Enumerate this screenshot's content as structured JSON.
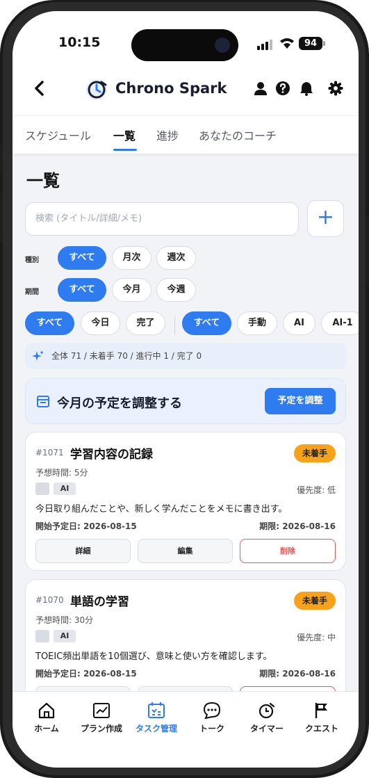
{
  "status_bar": {
    "time": "10:15",
    "battery": "94"
  },
  "header": {
    "app_name": "Chrono Spark"
  },
  "tabs": [
    {
      "label": "スケジュール"
    },
    {
      "label": "一覧"
    },
    {
      "label": "進捗"
    },
    {
      "label": "あなたのコーチ"
    }
  ],
  "page": {
    "title": "一覧",
    "search_placeholder": "検索 (タイトル/詳細/メモ)",
    "add_label": "+"
  },
  "filters": {
    "type_label": "種別",
    "type_options": [
      "すべて",
      "月次",
      "週次"
    ],
    "period_label": "期間",
    "period_options": [
      "すべて",
      "今月",
      "今週"
    ],
    "status_options": [
      "すべて",
      "今日",
      "完了"
    ],
    "source_options": [
      "すべて",
      "手動",
      "AI",
      "AI-1"
    ]
  },
  "stats": {
    "text": "全体 71 / 未着手 70 / 進行中 1 / 完了 0"
  },
  "adjust": {
    "text": "今月の予定を調整する",
    "button": "予定を調整"
  },
  "tasks": [
    {
      "id": "#1071",
      "title": "学習内容の記録",
      "status": "未着手",
      "estimate": "予想時間: 5分",
      "tag": "AI",
      "priority": "優先度: 低",
      "description": "今日取り組んだことや、新しく学んだことをメモに書き出す。",
      "start": "開始予定日: 2026-08-15",
      "due": "期限: 2026-08-16",
      "detail_label": "詳細",
      "edit_label": "編集",
      "delete_label": "削除"
    },
    {
      "id": "#1070",
      "title": "単語の学習",
      "status": "未着手",
      "estimate": "予想時間: 30分",
      "tag": "AI",
      "priority": "優先度: 中",
      "description": "TOEIC頻出単語を10個選び、意味と使い方を確認します。",
      "start": "開始予定日: 2026-08-15",
      "due": "期限: 2026-08-16"
    }
  ],
  "bottom_nav": [
    {
      "label": "ホーム",
      "icon": "home-icon"
    },
    {
      "label": "プラン作成",
      "icon": "chart-icon"
    },
    {
      "label": "タスク管理",
      "icon": "calendar-check-icon"
    },
    {
      "label": "トーク",
      "icon": "chat-icon"
    },
    {
      "label": "タイマー",
      "icon": "timer-icon"
    },
    {
      "label": "クエスト",
      "icon": "flag-icon"
    }
  ],
  "colors": {
    "accent": "#2f7bf0",
    "status_pending": "#f7a21b",
    "danger": "#e05a5a"
  }
}
